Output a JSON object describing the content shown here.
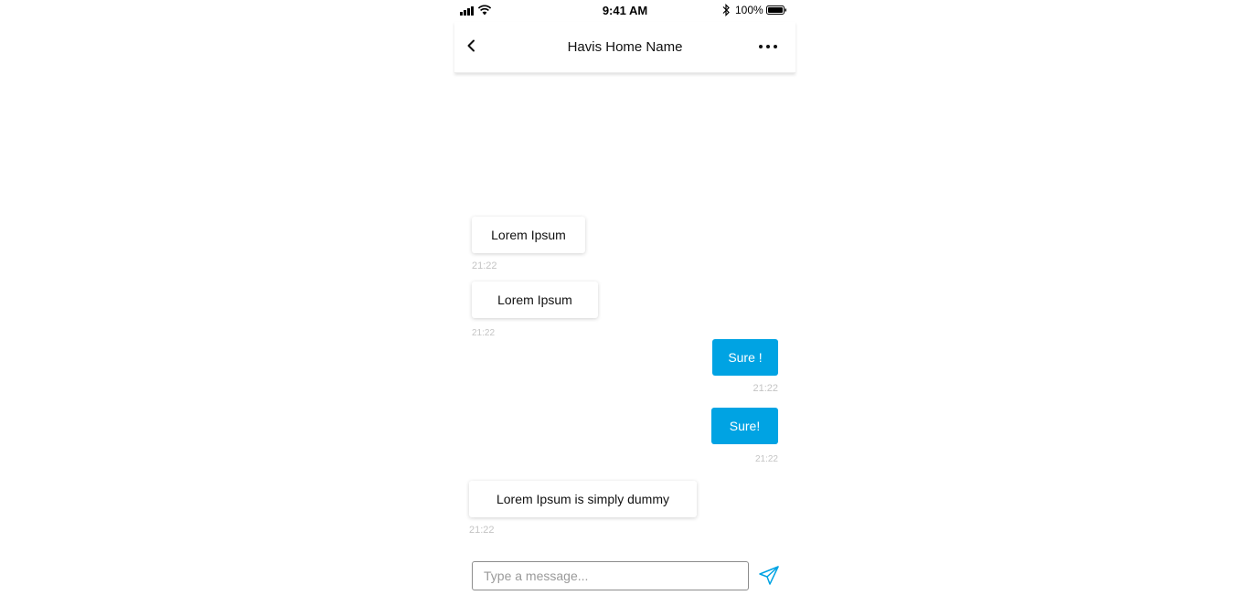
{
  "status_bar": {
    "time": "9:41 AM",
    "battery_percent": "100%",
    "icons": [
      "signal-icon",
      "wifi-icon",
      "bluetooth-icon",
      "battery-icon"
    ]
  },
  "header": {
    "title": "Havis Home Name",
    "back_icon": "chevron-left-icon",
    "more_icon": "more-horizontal-icon"
  },
  "messages": [
    {
      "direction": "incoming",
      "text": "Lorem Ipsum",
      "time": "21:22"
    },
    {
      "direction": "incoming",
      "text": "Lorem Ipsum",
      "time": "21:22"
    },
    {
      "direction": "outgoing",
      "text": "Sure !",
      "time": "21:22"
    },
    {
      "direction": "outgoing",
      "text": "Sure!",
      "time": "21:22"
    },
    {
      "direction": "incoming",
      "text": "Lorem Ipsum is simply dummy",
      "time": "21:22"
    }
  ],
  "composer": {
    "placeholder": "Type a message...",
    "value": "",
    "send_icon": "send-icon"
  },
  "colors": {
    "accent": "#00a3e3",
    "timestamp": "#c4c4c4",
    "background": "#ffffff"
  }
}
